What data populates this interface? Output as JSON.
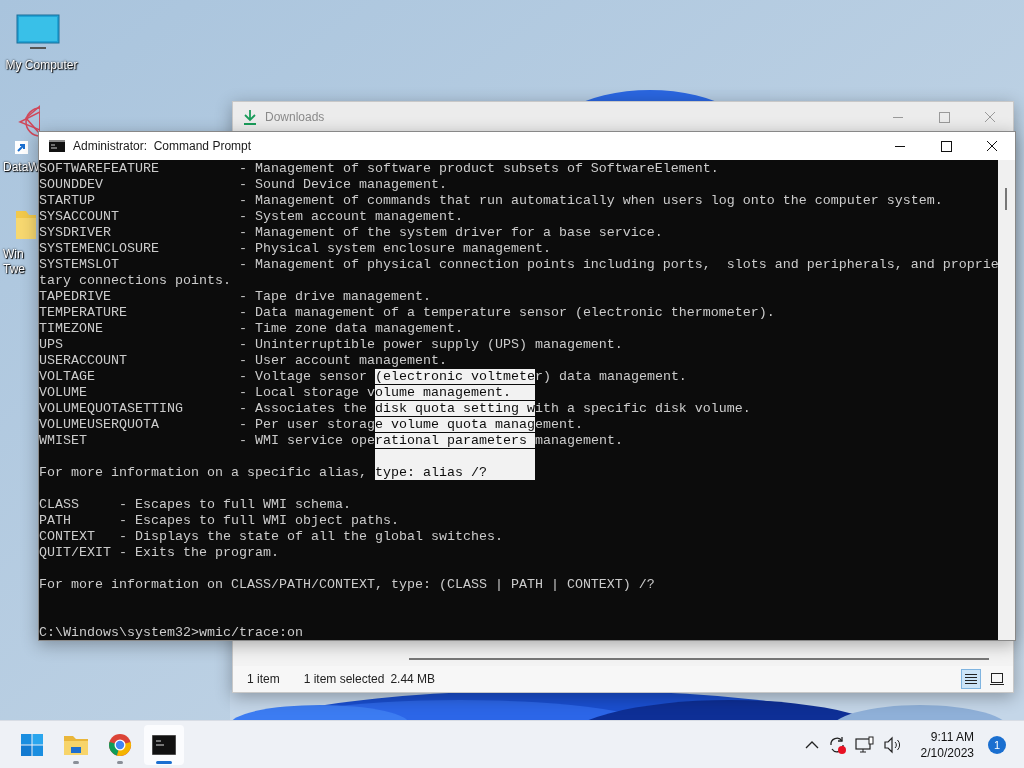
{
  "desktop_icons": [
    {
      "kind": "computer",
      "label_lines": [
        "My Computer"
      ],
      "shortcut": false
    },
    {
      "kind": "app",
      "label_lines": [
        "DataW"
      ],
      "shortcut": true
    },
    {
      "kind": "folder",
      "label_lines": [
        "Win",
        "Twe"
      ],
      "shortcut": false
    }
  ],
  "explorer": {
    "title": "Downloads",
    "active": false,
    "status": {
      "items": "1 item",
      "selection": "1 item selected",
      "size": "2.44 MB"
    },
    "views": [
      {
        "kind": "details",
        "selected": true
      },
      {
        "kind": "tiles",
        "selected": false
      }
    ]
  },
  "console": {
    "title": "Administrator:  Command Prompt",
    "active": true,
    "lines": [
      {
        "kind": "text",
        "text": "SOFTWAREFEATURE          - Management of software product subsets of SoftwareElement."
      },
      {
        "kind": "text",
        "text": "SOUNDDEV                 - Sound Device management."
      },
      {
        "kind": "text",
        "text": "STARTUP                  - Management of commands that run automatically when users log onto the computer system."
      },
      {
        "kind": "text",
        "text": "SYSACCOUNT               - System account management."
      },
      {
        "kind": "text",
        "text": "SYSDRIVER                - Management of the system driver for a base service."
      },
      {
        "kind": "text",
        "text": "SYSTEMENCLOSURE          - Physical system enclosure management."
      },
      {
        "kind": "text",
        "text": "SYSTEMSLOT               - Management of physical connection points including ports,  slots and peripherals, and proprie"
      },
      {
        "kind": "text",
        "text": "tary connections points."
      },
      {
        "kind": "text",
        "text": "TAPEDRIVE                - Tape drive management."
      },
      {
        "kind": "text",
        "text": "TEMPERATURE              - Data management of a temperature sensor (electronic thermometer)."
      },
      {
        "kind": "text",
        "text": "TIMEZONE                 - Time zone data management."
      },
      {
        "kind": "text",
        "text": "UPS                      - Uninterruptible power supply (UPS) management."
      },
      {
        "kind": "text",
        "text": "USERACCOUNT              - User account management."
      },
      {
        "kind": "split",
        "segments": [
          {
            "text": "VOLTAGE                  - Voltage sensor ",
            "selected": false
          },
          {
            "text": "(electronic voltmete",
            "selected": true
          },
          {
            "text": "r) data management.",
            "selected": false
          }
        ]
      },
      {
        "kind": "split",
        "segments": [
          {
            "text": "VOLUME                   - Local storage v",
            "selected": false
          },
          {
            "text": "olume management.   ",
            "selected": true
          }
        ]
      },
      {
        "kind": "split",
        "segments": [
          {
            "text": "VOLUMEQUOTASETTING       - Associates the ",
            "selected": false
          },
          {
            "text": "disk quota setting w",
            "selected": true
          },
          {
            "text": "ith a specific disk volume.",
            "selected": false
          }
        ]
      },
      {
        "kind": "split",
        "segments": [
          {
            "text": "VOLUMEUSERQUOTA          - Per user storag",
            "selected": false
          },
          {
            "text": "e volume quota manag",
            "selected": true
          },
          {
            "text": "ement.",
            "selected": false
          }
        ]
      },
      {
        "kind": "split",
        "segments": [
          {
            "text": "WMISET                   - WMI service ope",
            "selected": false
          },
          {
            "text": "rational parameters ",
            "selected": true
          },
          {
            "text": "management.",
            "selected": false
          }
        ]
      },
      {
        "kind": "blank",
        "selected": true
      },
      {
        "kind": "split",
        "segments": [
          {
            "text": "For more information on a specific alias, ",
            "selected": false
          },
          {
            "text": "type: alias /?      ",
            "selected": true
          }
        ]
      },
      {
        "kind": "blank",
        "selected": false
      },
      {
        "kind": "text",
        "text": "CLASS     - Escapes to full WMI schema."
      },
      {
        "kind": "text",
        "text": "PATH      - Escapes to full WMI object paths."
      },
      {
        "kind": "text",
        "text": "CONTEXT   - Displays the state of all the global switches."
      },
      {
        "kind": "text",
        "text": "QUIT/EXIT - Exits the program."
      },
      {
        "kind": "blank",
        "selected": false
      },
      {
        "kind": "text",
        "text": "For more information on CLASS/PATH/CONTEXT, type: (CLASS | PATH | CONTEXT) /?"
      },
      {
        "kind": "blank",
        "selected": false
      },
      {
        "kind": "blank",
        "selected": false
      },
      {
        "kind": "text",
        "text": "C:\\Windows\\system32>wmic/trace:on"
      }
    ]
  },
  "taskbar": {
    "apps": [
      {
        "kind": "start",
        "running": false,
        "selected": false
      },
      {
        "kind": "files",
        "running": true,
        "selected": false
      },
      {
        "kind": "browser",
        "running": true,
        "selected": false
      },
      {
        "kind": "console",
        "running": true,
        "selected": true
      }
    ],
    "time": "9:11 AM",
    "date": "2/10/2023",
    "notifications": "1"
  }
}
